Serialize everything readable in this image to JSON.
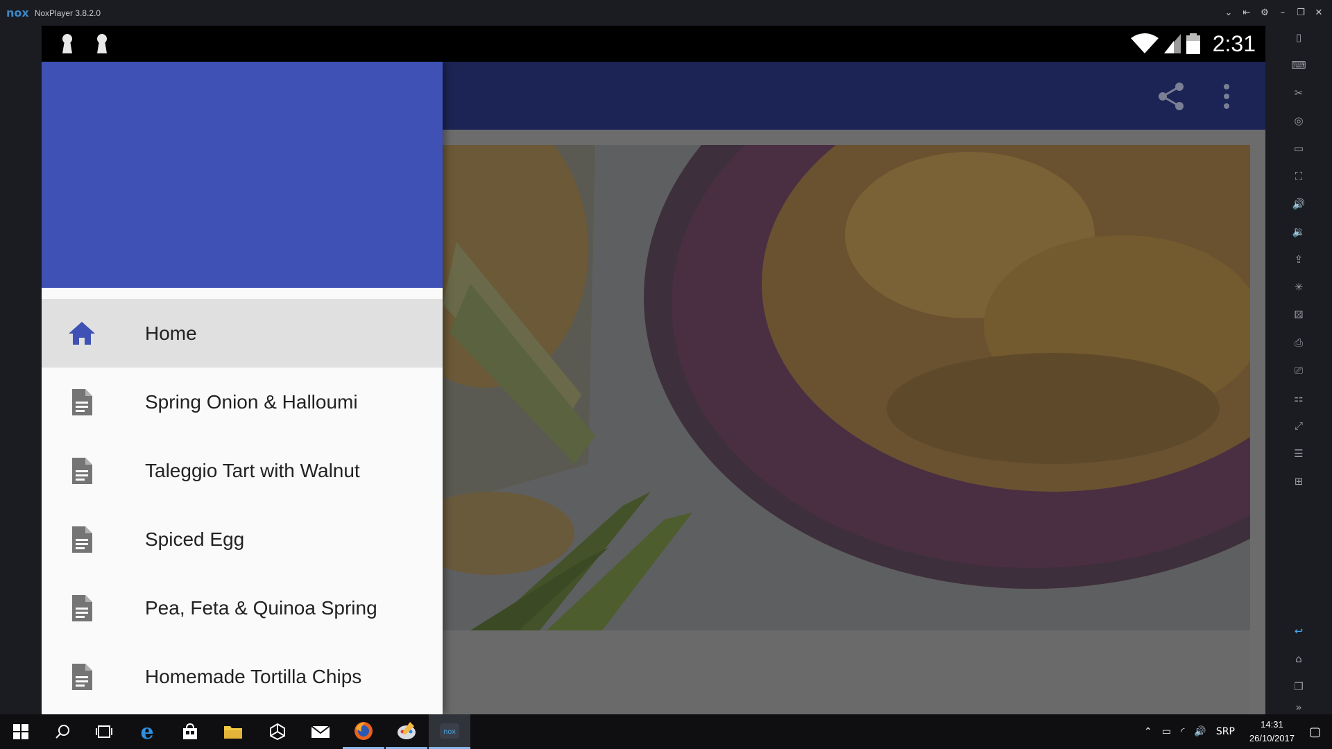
{
  "window": {
    "logo_text": "nox",
    "title": "NoxPlayer 3.8.2.0",
    "controls": [
      "⌄",
      "⇤",
      "⚙",
      "–",
      "❐",
      "✕"
    ]
  },
  "statusbar": {
    "time": "2:31"
  },
  "drawer": {
    "header_color": "#3f51b5",
    "items": [
      {
        "label": "Home",
        "icon": "home-icon",
        "selected": true
      },
      {
        "label": "Spring Onion & Halloumi",
        "icon": "document-icon",
        "selected": false
      },
      {
        "label": "Taleggio Tart with Walnut",
        "icon": "document-icon",
        "selected": false
      },
      {
        "label": "Spiced Egg",
        "icon": "document-icon",
        "selected": false
      },
      {
        "label": "Pea, Feta & Quinoa Spring",
        "icon": "document-icon",
        "selected": false
      },
      {
        "label": "Homemade Tortilla Chips",
        "icon": "document-icon",
        "selected": false
      }
    ]
  },
  "appbar": {
    "actions": [
      "share-icon",
      "more-vert-icon"
    ]
  },
  "taskbar": {
    "apps": [
      "windows-start-icon",
      "search-icon",
      "task-view-icon",
      "edge-icon",
      "store-icon",
      "file-explorer-icon",
      "unity-icon",
      "mail-icon",
      "firefox-icon",
      "paint-icon",
      "nox-icon"
    ],
    "tray": {
      "language": "SRP",
      "time": "14:31",
      "date": "26/10/2017"
    }
  },
  "colors": {
    "accent": "#3f51b5",
    "appbar_dimmed": "#1b2455",
    "emulator_bg": "#1b1c21"
  }
}
